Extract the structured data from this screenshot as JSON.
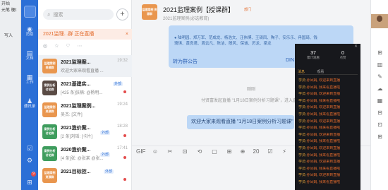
{
  "left_strip": {
    "line1": "开始",
    "line2": "元笔 梗t",
    "line3": "写入"
  },
  "rail": {
    "items": [
      {
        "label": "消息",
        "icon": "chat-icon"
      },
      {
        "label": "文档",
        "icon": "doc-icon"
      },
      {
        "label": "工作",
        "icon": "work-icon"
      },
      {
        "label": "通讯录",
        "icon": "contacts-icon"
      }
    ],
    "badge": "9"
  },
  "conv_list": {
    "search_placeholder": "搜索",
    "add": "+",
    "live_banner": "2021监理...群 正在直播",
    "live_close": "×",
    "filters": [
      "◎",
      "☆",
      "♡",
      "⋯"
    ],
    "items": [
      {
        "icon_text": "监理案例 资源群",
        "name": "2021监理案...",
        "time": "19:32",
        "preview": "欢迎大家来观看直播 ...",
        "sel": true,
        "style": "o",
        "badge": ""
      },
      {
        "icon_text": "案例分析 讨论群",
        "name": "2021基建实...",
        "time": "",
        "preview": "[425 条]张楠: @杨明...",
        "sel": false,
        "style": "d",
        "badge": "外部"
      },
      {
        "icon_text": "监理案例 资源群",
        "name": "2021监理案例...",
        "time": "19:24",
        "preview": "吴杰: [文件]",
        "sel": false,
        "style": "o",
        "badge": ""
      },
      {
        "icon_text": "案例分析 讨论群",
        "name": "2021造价案...",
        "time": "18:28",
        "preview": "[2 条]刘瑶: [卡片]",
        "sel": false,
        "style": "g",
        "badge": "外部"
      },
      {
        "icon_text": "案例分析 讨论群",
        "name": "2020造价案...",
        "time": "17:41",
        "preview": "[4 条]张: @张某 @张...",
        "sel": false,
        "style": "g",
        "badge": "外部"
      },
      {
        "icon_text": "监理案例 资源群",
        "name": "2021目标控...",
        "time": "",
        "preview": "",
        "sel": false,
        "style": "o",
        "badge": "外部"
      }
    ]
  },
  "chat": {
    "icon_text": "监理案例 资源群",
    "title": "2021监理案例【授课群】",
    "tag": "部门",
    "subtitle": "2021监理案例(必选教育)",
    "notice_names": "● 陆明园、郑万军、范成龙、杨浩文、汪伟博、王硕凤、陶子、安乐乐、冉国琦、钱琦琪、黄良君、周云凡、陈洁、殷风、保诚、厉龙、梁龙",
    "notice_btn": "转为群公告",
    "notice_btn2": "DIN",
    "sys1": "刚刚",
    "sys2": "付贤富发起直播 \"1月18日案例分析习题课\"，进入直播",
    "message": "欢迎大家来观看直播 \"1月18日案例分析习题课\"",
    "tools": [
      "GIF",
      "☺",
      "✂",
      "⊡",
      "⟲",
      "▢",
      "⊞",
      "⊕",
      "20",
      "☑",
      "⚡",
      "▤"
    ]
  },
  "live_panel": {
    "viewers": "37",
    "viewers_label": "累计观看",
    "likes": "0",
    "likes_label": "点赞",
    "tab_on": "消息",
    "tab_off": "观看",
    "comments": [
      {
        "user": "学员:",
        "text": "孙凤娟, 欢迎来到直播"
      },
      {
        "user": "学员:",
        "text": "孙凤娟, 我来看直播啦"
      },
      {
        "user": "学员:",
        "text": "孙凤娟, 欢迎来到直播"
      },
      {
        "user": "学员:",
        "text": "孙凤娟, 我来看直播啦"
      },
      {
        "user": "学员:",
        "text": "孙凤娟, 欢迎来到直播"
      },
      {
        "user": "学员:",
        "text": "孙凤娟, 我来看直播啦"
      },
      {
        "user": "学员:",
        "text": "孙凤娟, 欢迎来到直播"
      },
      {
        "user": "学员:",
        "text": "孙凤娟, 我来看直播啦"
      },
      {
        "user": "学员:",
        "text": "孙凤娟, 欢迎来到直播"
      },
      {
        "user": "学员:",
        "text": "孙凤娟, 我来看直播啦"
      },
      {
        "user": "学员:",
        "text": "孙凤娟, 欢迎来到直播"
      },
      {
        "user": "学员:",
        "text": "孙凤娟, 我来看直播啦"
      },
      {
        "user": "学员:",
        "text": "孙凤娟, 欢迎来到直播"
      },
      {
        "user": "学员:",
        "text": "孙凤娟, 我来看直播啦"
      },
      {
        "user": "学员:",
        "text": "孙凤娟, 欢迎来到直播"
      },
      {
        "user": "学员:",
        "text": "孙凤娟, 我来看直播啦"
      }
    ]
  },
  "right_bar": [
    "⊞",
    "▥",
    "✎",
    "☁",
    "▦",
    "⊟",
    "⊡",
    "⊞"
  ]
}
